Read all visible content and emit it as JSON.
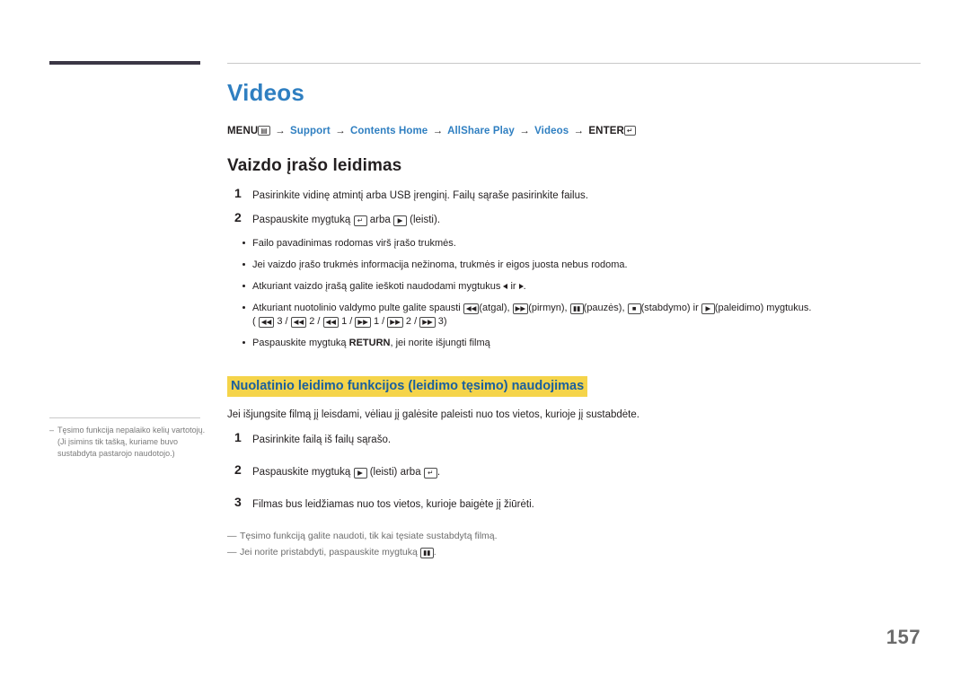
{
  "page": {
    "number": "157"
  },
  "title": "Videos",
  "menu_path": {
    "menu_label": "MENU",
    "menu_icon": "menu-icon",
    "items": [
      "Support",
      "Contents Home",
      "AllShare Play",
      "Videos"
    ],
    "enter_label": "ENTER",
    "enter_icon": "enter-key-icon",
    "arrow": "→"
  },
  "section1": {
    "heading": "Vaizdo įrašo leidimas",
    "steps": [
      {
        "num": "1",
        "text": "Pasirinkite vidinę atmintį arba USB įrenginį. Failų sąraše pasirinkite failus."
      },
      {
        "num": "2",
        "text_before": "Paspauskite mygtuką",
        "key1": "enter-key-icon",
        "text_mid": "arba",
        "key2": "play-icon",
        "text_after": "(leisti)."
      }
    ],
    "bullets": [
      "Failo pavadinimas rodomas virš įrašo trukmės.",
      "Jei vaizdo įrašo trukmės informacija nežinoma, trukmės ir eigos juosta nebus rodoma.",
      "Atkuriant vaizdo įrašą galite ieškoti naudodami mygtukus ◀ ir ▶.",
      "Atkuriant nuotolinio valdymo pulte galite spausti ◀◀(atgal), ▶▶(pirmyn), ▮▮(pauzės), ■(stabdymo) ir ▶(paleidimo) mygtukus. ( ◀◀ 3 / ◀◀ 2 / ◀◀ 1 / ▶▶ 1 / ▶▶ 2 / ▶▶ 3)",
      "Paspauskite mygtuką RETURN, jei norite išjungti filmą"
    ]
  },
  "section2": {
    "heading": "Nuolatinio leidimo funkcijos (leidimo tęsimo) naudojimas",
    "intro": "Jei išjungsite filmą jį leisdami, vėliau jį galėsite paleisti nuo tos vietos, kurioje jį sustabdėte.",
    "steps": [
      {
        "num": "1",
        "text": "Pasirinkite failą iš failų sąrašo."
      },
      {
        "num": "2",
        "text_before": "Paspauskite mygtuką",
        "key1": "play-icon",
        "text_mid": "(leisti) arba",
        "key2": "enter-key-icon",
        "text_after": "."
      },
      {
        "num": "3",
        "text": "Filmas bus leidžiamas nuo tos vietos, kurioje baigėte jį žiūrėti."
      }
    ],
    "notes": [
      "Tęsimo funkciją galite naudoti, tik kai tęsiate sustabdytą filmą.",
      "Jei norite pristabdyti, paspauskite mygtuką ▮▮."
    ]
  },
  "sidebar_note": {
    "text": "Tęsimo funkcija nepalaiko kelių vartotojų. (Ji įsimins tik tašką, kuriame buvo sustabdyta pastarojo naudotojo.)"
  },
  "colors": {
    "title_blue": "#2f7fc1",
    "highlight_yellow": "#f5d44a",
    "rule_dark": "#3b3745"
  }
}
